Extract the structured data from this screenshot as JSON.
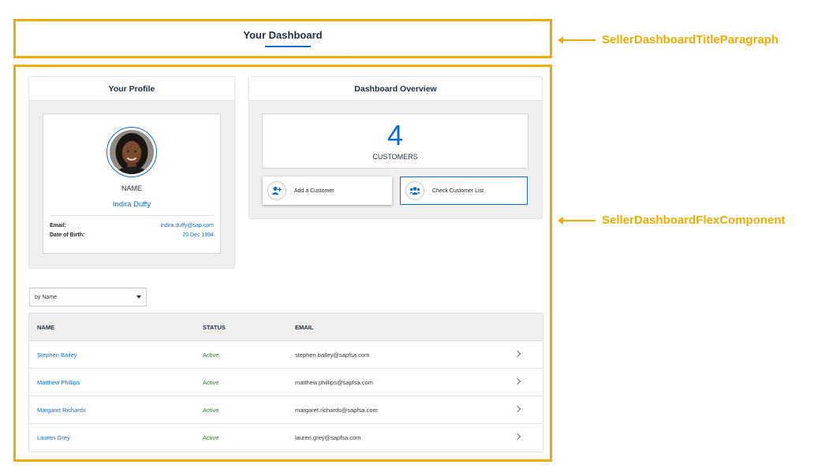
{
  "header": {
    "title": "Your Dashboard"
  },
  "callouts": {
    "title_paragraph": "SellerDashboardTitleParagraph",
    "flex_component": "SellerDashboardFlexComponent"
  },
  "profile": {
    "panel_title": "Your Profile",
    "name_label": "NAME",
    "name_value": "Indira Duffy",
    "email_label": "Email:",
    "email_value": "indira.duffy@sap.com",
    "dob_label": "Date of Birth:",
    "dob_value": "20 Dec 1994"
  },
  "overview": {
    "panel_title": "Dashboard Overview",
    "customer_count": "4",
    "customer_label": "CUSTOMERS",
    "add_customer_label": "Add a Customer",
    "check_list_label": "Check Customer List"
  },
  "filter": {
    "selected": "by Name"
  },
  "table": {
    "headers": {
      "name": "NAME",
      "status": "STATUS",
      "email": "EMAIL"
    },
    "rows": [
      {
        "name": "Stephen Bailey",
        "status": "Active",
        "email": "stephen.bailey@sapfsa.com"
      },
      {
        "name": "Matthew Phillips",
        "status": "Active",
        "email": "matthew.phillips@sapfsa.com"
      },
      {
        "name": "Margaret Richards",
        "status": "Active",
        "email": "margaret.richards@sapfsa.com"
      },
      {
        "name": "Lauren Grey",
        "status": "Active",
        "email": "lauren.grey@sapfsa.com"
      }
    ]
  },
  "colors": {
    "callout": "#f0ab00",
    "accent": "#0a6ed1",
    "status_active": "#2b7d2b"
  },
  "icons": {
    "add_customer": "add-user-icon",
    "check_list": "group-icon",
    "row_nav": "chevron-right-icon",
    "dropdown": "caret-down-icon"
  }
}
